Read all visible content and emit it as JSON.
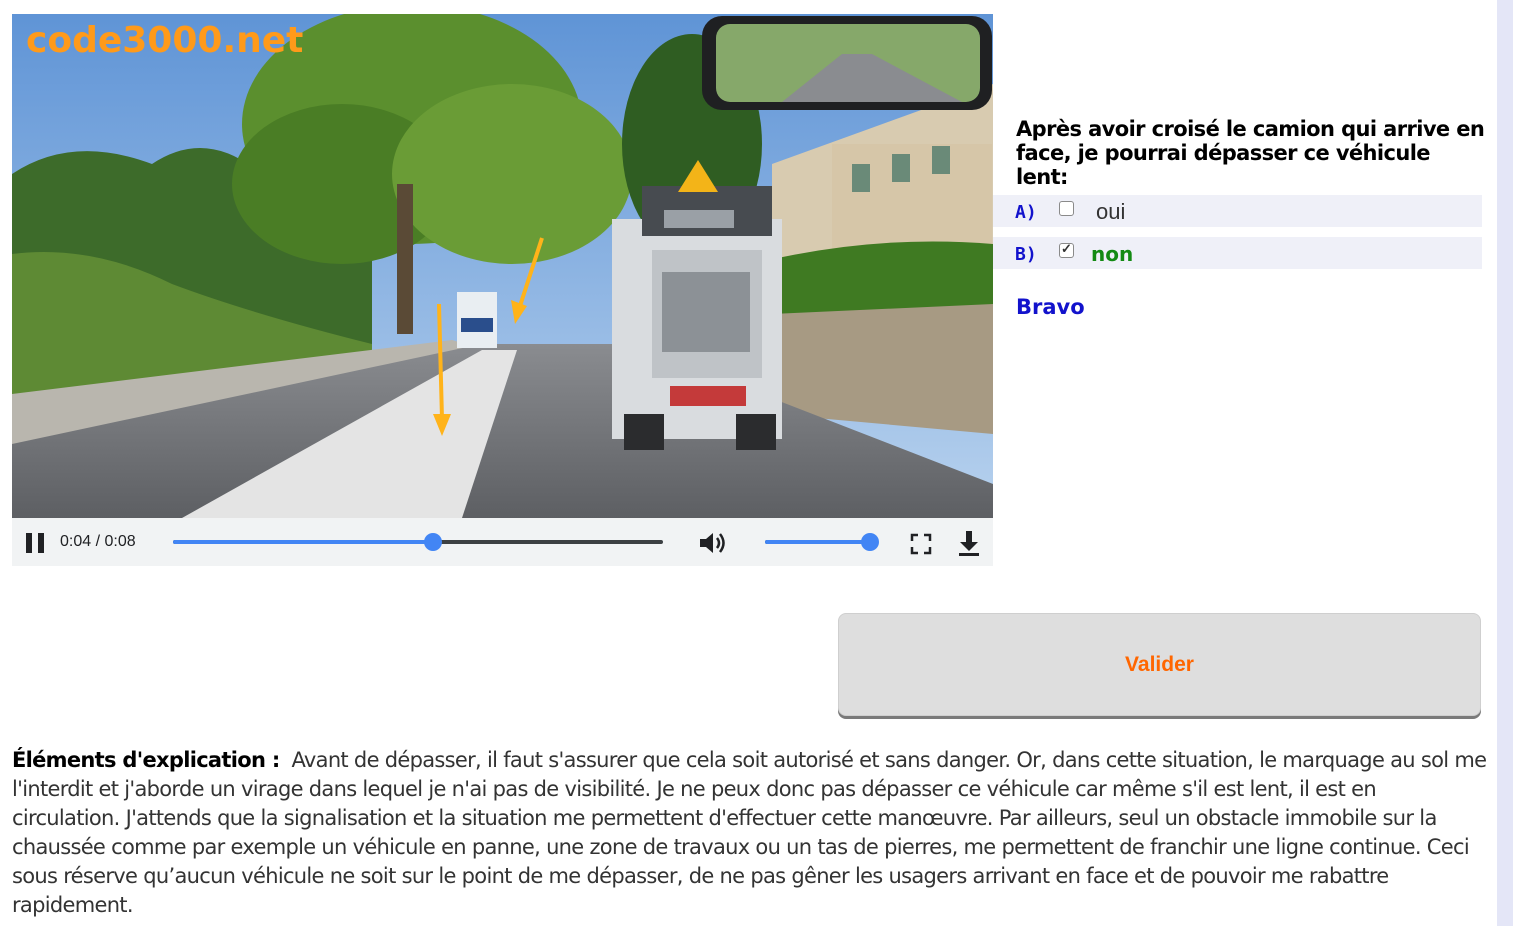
{
  "video": {
    "watermark": "code3000.net",
    "current_time": "0:04",
    "duration": "0:08",
    "time_separator": " / ",
    "progress_fraction": 0.53,
    "volume_fraction": 0.99,
    "state": "playing"
  },
  "icons": {
    "pause": "pause-icon",
    "volume": "volume-icon",
    "fullscreen": "fullscreen-icon",
    "download": "download-icon"
  },
  "question": {
    "text": "Après avoir croisé le camion qui arrive en face, je pourrai dépasser ce véhicule lent:",
    "answers": [
      {
        "letter": "A)",
        "label": "oui",
        "checked": false
      },
      {
        "letter": "B)",
        "label": "non",
        "checked": true
      }
    ],
    "feedback": "Bravo"
  },
  "actions": {
    "validate_label": "Valider"
  },
  "explanation": {
    "label": "Éléments d'explication :",
    "text": "Avant de dépasser, il faut s'assurer que cela soit autorisé et sans danger. Or, dans cette situation, le marquage au sol me l'interdit et j'aborde un virage dans lequel je n'ai pas de visibilité. Je ne peux donc pas dépasser ce véhicule car même s'il est lent, il est en circulation. J'attends que la signalisation et la situation me permettent d'effectuer cette manœuvre. Par ailleurs, seul un obstacle immobile sur la chaussée comme par exemple un véhicule en panne, une zone de travaux ou un tas de pierres, me permettent de franchir une ligne continue. Ceci sous réserve qu’aucun véhicule ne soit sur le point de me dépasser, de ne pas gêner les usagers arrivant en face et de pouvoir me rabattre rapidement."
  },
  "colors": {
    "accent_blue": "#4285f4",
    "question_letter": "#1212cc",
    "correct_green": "#138a13",
    "valider_orange": "#ff6600",
    "watermark_orange": "#ff9a1a"
  }
}
